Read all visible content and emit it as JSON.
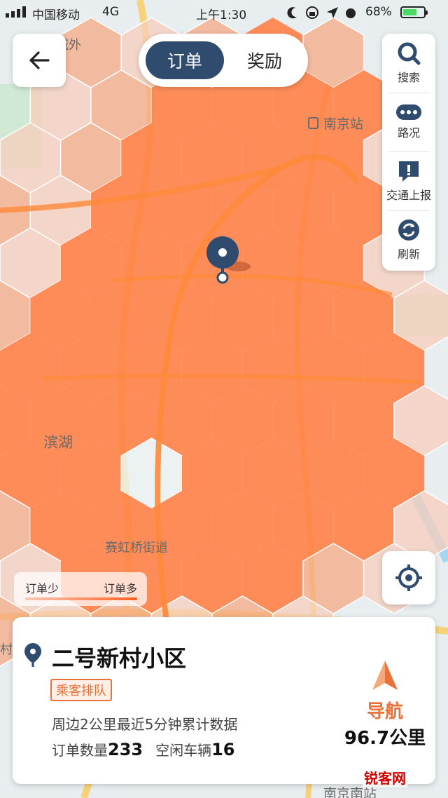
{
  "status_bar": {
    "carrier": "中国移动",
    "network": "4G",
    "time": "上午1:30",
    "battery_percent": "68%",
    "battery_level": 0.68
  },
  "top_tabs": {
    "orders": "订单",
    "rewards": "奖励",
    "active": "orders"
  },
  "side_panel": {
    "search": "搜索",
    "traffic": "路况",
    "report": "交通上报",
    "refresh": "刷新"
  },
  "map_labels": {
    "outer": "城外",
    "nanjing_station": "南京站",
    "lake": "滨湖",
    "street": "赛虹桥街道",
    "village": "村",
    "south_station": "南京南站"
  },
  "legend": {
    "low": "订单少",
    "high": "订单多"
  },
  "info_card": {
    "place": "二号新村小区",
    "badge": "乘客排队",
    "description": "周边2公里最近5分钟累计数据",
    "order_label": "订单数量",
    "order_count": "233",
    "idle_label": "空闲车辆",
    "idle_count": "16",
    "nav_label": "导航",
    "distance": "96.7公里"
  },
  "watermark": "锐客网",
  "colors": {
    "heat_high": "#ff7e43",
    "heat_mid": "#f5a884",
    "heat_low": "#f7cdbc",
    "accent_navy": "#2f4b6e",
    "accent_orange": "#e8723a"
  }
}
